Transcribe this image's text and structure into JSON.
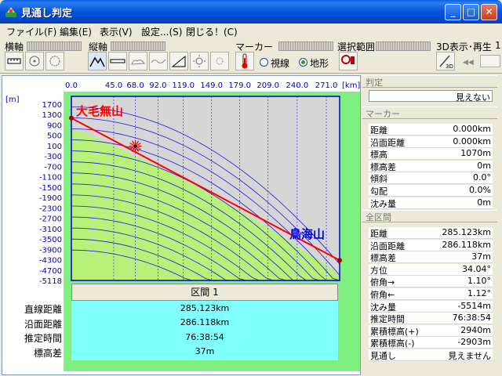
{
  "window": {
    "title": "見通し判定",
    "icon": "app-icon"
  },
  "menu": [
    {
      "label": "ファイル(F)"
    },
    {
      "label": "編集(E)"
    },
    {
      "label": "表示(V)"
    },
    {
      "label": "設定...(S)"
    },
    {
      "label": "閉じる！(C)"
    }
  ],
  "toolbar": {
    "horizontal_axis_label": "横軸",
    "vertical_axis_label": "縦軸",
    "marker_label": "マーカー",
    "range_label": "選択範囲",
    "view3d_label": "3D表示･再生",
    "view3d_value": "1",
    "radio_line": "視線",
    "radio_terrain": "地形",
    "radio_selected": "地形"
  },
  "chart_data": {
    "type": "line",
    "x_unit": "[km]",
    "y_unit": "[m]",
    "x_ticks": [
      "0.0",
      "45.0",
      "68.0",
      "92.0",
      "119.0",
      "149.0",
      "179.0",
      "209.0",
      "240.0",
      "271.0"
    ],
    "y_ticks": [
      "1700",
      "1300",
      "900",
      "500",
      "100",
      "-300",
      "-700",
      "-1100",
      "-1500",
      "-1900",
      "-2300",
      "-2700",
      "-3100",
      "-3500",
      "-3900",
      "-4300",
      "-4700",
      "-5118"
    ],
    "x_range": [
      0,
      285.123
    ],
    "y_range": [
      -5118,
      1900
    ],
    "start_label": "大毛無山",
    "end_label": "鳥海山",
    "line_of_sight": [
      {
        "x": 0,
        "y": 1070
      },
      {
        "x": 285.123,
        "y": -4350
      }
    ],
    "obstruction": {
      "x": 68,
      "y": 0
    },
    "colors": {
      "sky": "#d8d8d8",
      "terrain": "#b8f07a",
      "ground": "#a4ec6a",
      "line": "#ff0000",
      "curves": "#1818e0"
    }
  },
  "summary": {
    "header": "区間 1",
    "rows": [
      {
        "label": "直線距離",
        "value": "285.123km"
      },
      {
        "label": "沿面距離",
        "value": "286.118km"
      },
      {
        "label": "推定時間",
        "value": "76:38:54"
      },
      {
        "label": "標高差",
        "value": "37m"
      }
    ]
  },
  "side": {
    "judge_head": "判定",
    "judge_value": "見えない",
    "marker_head": "マーカー",
    "marker_rows": [
      {
        "k": "距離",
        "v": "0.000km"
      },
      {
        "k": "沿面距離",
        "v": "0.000km"
      },
      {
        "k": "標高",
        "v": "1070m"
      },
      {
        "k": "標高差",
        "v": "0m"
      },
      {
        "k": "傾斜",
        "v": "0.0°"
      },
      {
        "k": "勾配",
        "v": "0.0%"
      },
      {
        "k": "沈み量",
        "v": "0m"
      }
    ],
    "total_head": "全区間",
    "total_rows": [
      {
        "k": "距離",
        "v": "285.123km"
      },
      {
        "k": "沿面距離",
        "v": "286.118km"
      },
      {
        "k": "標高差",
        "v": "37m"
      },
      {
        "k": "方位",
        "v": "34.04°"
      },
      {
        "k": "俯角→",
        "v": "1.10°"
      },
      {
        "k": "俯角←",
        "v": "1.12°"
      },
      {
        "k": "沈み量",
        "v": "-5514m"
      },
      {
        "k": "推定時間",
        "v": "76:38:54"
      },
      {
        "k": "累積標高(+)",
        "v": "2940m"
      },
      {
        "k": "累積標高(-)",
        "v": "-2903m"
      },
      {
        "k": "見通し",
        "v": "見えません"
      }
    ]
  }
}
